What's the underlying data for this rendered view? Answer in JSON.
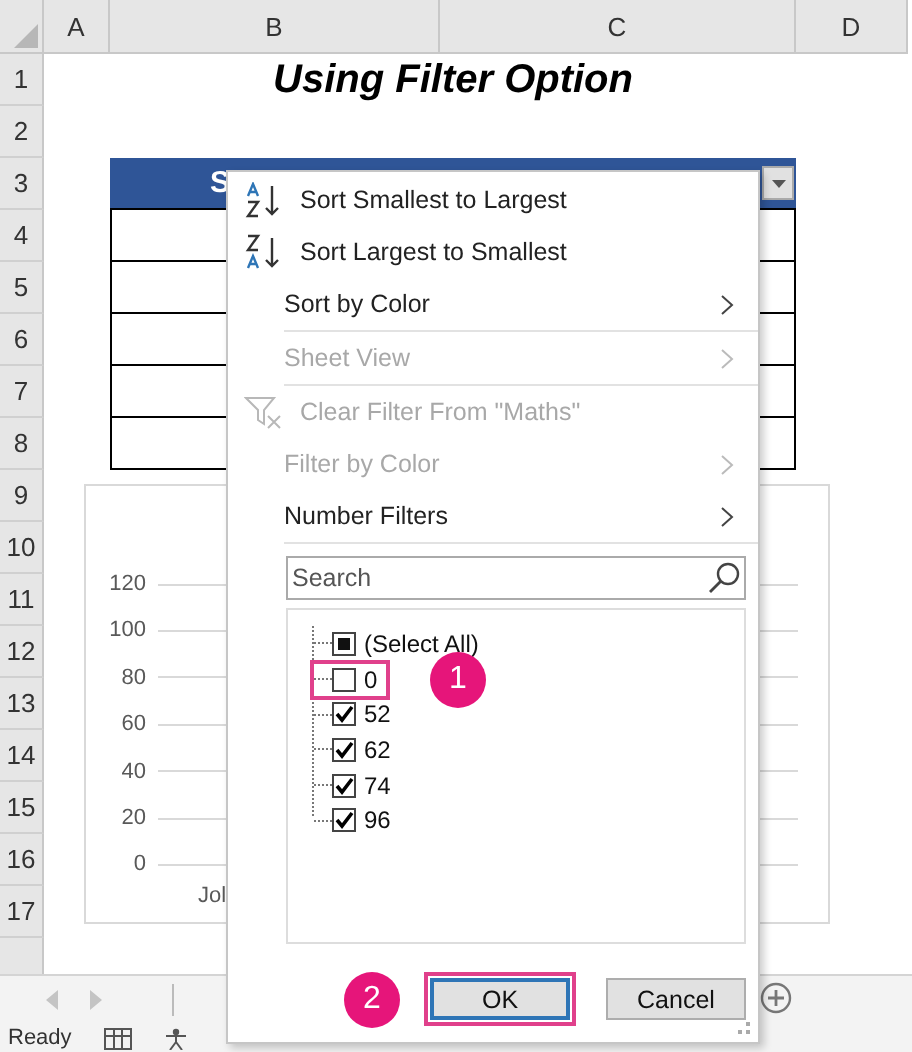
{
  "columns": [
    "A",
    "B",
    "C",
    "D"
  ],
  "rows": [
    "1",
    "2",
    "3",
    "4",
    "5",
    "6",
    "7",
    "8",
    "9",
    "10",
    "11",
    "12",
    "13",
    "14",
    "15",
    "16",
    "17"
  ],
  "title": "Using Filter Option",
  "table": {
    "header": [
      "S"
    ]
  },
  "chart": {
    "yticks": [
      "120",
      "100",
      "80",
      "60",
      "40",
      "20",
      "0"
    ],
    "xlabel": "Jol"
  },
  "menu": {
    "items": [
      {
        "label": "Sort Smallest to Largest",
        "kind": "sort-asc",
        "disabled": false,
        "submenu": false
      },
      {
        "label": "Sort Largest to Smallest",
        "kind": "sort-desc",
        "disabled": false,
        "submenu": false
      },
      {
        "label": "Sort by Color",
        "kind": "plain",
        "disabled": false,
        "submenu": true
      },
      {
        "label": "Sheet View",
        "kind": "plain",
        "disabled": true,
        "submenu": true
      },
      {
        "label": "Clear Filter From \"Maths\"",
        "kind": "clear",
        "disabled": true,
        "submenu": false
      },
      {
        "label": "Filter by Color",
        "kind": "plain",
        "disabled": true,
        "submenu": true
      },
      {
        "label": "Number Filters",
        "kind": "plain",
        "disabled": false,
        "submenu": true
      }
    ],
    "search": {
      "placeholder": "Search"
    },
    "values": [
      {
        "label": "(Select All)",
        "checked": false,
        "partial": true,
        "highlighted": false
      },
      {
        "label": "0",
        "checked": false,
        "partial": false,
        "highlighted": true,
        "callout": "1"
      },
      {
        "label": "52",
        "checked": true,
        "highlighted": false
      },
      {
        "label": "62",
        "checked": true,
        "highlighted": false
      },
      {
        "label": "74",
        "checked": true,
        "highlighted": false
      },
      {
        "label": "96",
        "checked": true,
        "highlighted": false
      }
    ],
    "buttons": [
      {
        "label": "OK",
        "highlighted": true,
        "callout": "2"
      },
      {
        "label": "Cancel",
        "highlighted": false
      }
    ]
  },
  "status_bar": {
    "text": "Ready"
  }
}
